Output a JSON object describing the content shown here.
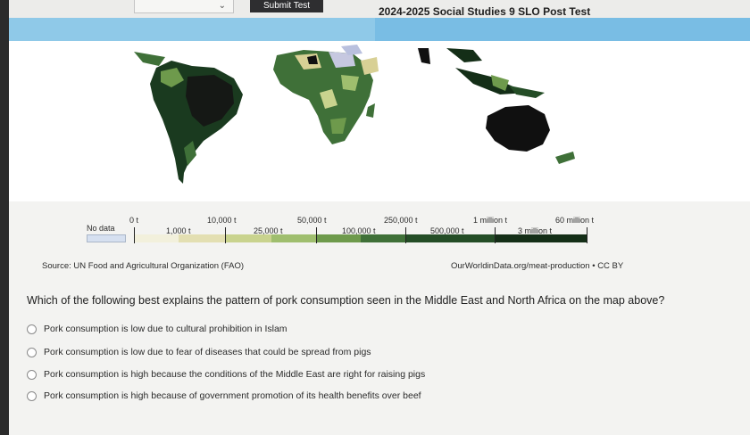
{
  "header": {
    "submit_label": "Submit Test",
    "test_title": "2024-2025 Social Studies 9 SLO Post Test"
  },
  "legend": {
    "no_data": "No data",
    "labels_top": [
      "0 t",
      "10,000 t",
      "50,000 t",
      "250,000 t",
      "1 million t",
      "60 million t"
    ],
    "labels_bottom": [
      "1,000 t",
      "25,000 t",
      "100,000 t",
      "500,000 t",
      "3 million t"
    ],
    "colors": [
      "#f2f0dc",
      "#e3dfb2",
      "#c9d38e",
      "#9fbe6e",
      "#6e9a4c",
      "#3f7038",
      "#244d26",
      "#142e17"
    ]
  },
  "source": {
    "left": "Source: UN Food and Agricultural Organization (FAO)",
    "right": "OurWorldinData.org/meat-production • CC BY"
  },
  "question": {
    "text": "Which of the following best explains the pattern of pork consumption seen in the Middle East and North Africa on the map above?",
    "options": [
      "Pork consumption is low due to cultural prohibition in Islam",
      "Pork consumption is low due to fear of diseases that could be spread from pigs",
      "Pork consumption is high because the conditions of the Middle East are right for raising pigs",
      "Pork consumption is high because of government promotion of its health benefits over beef"
    ]
  }
}
